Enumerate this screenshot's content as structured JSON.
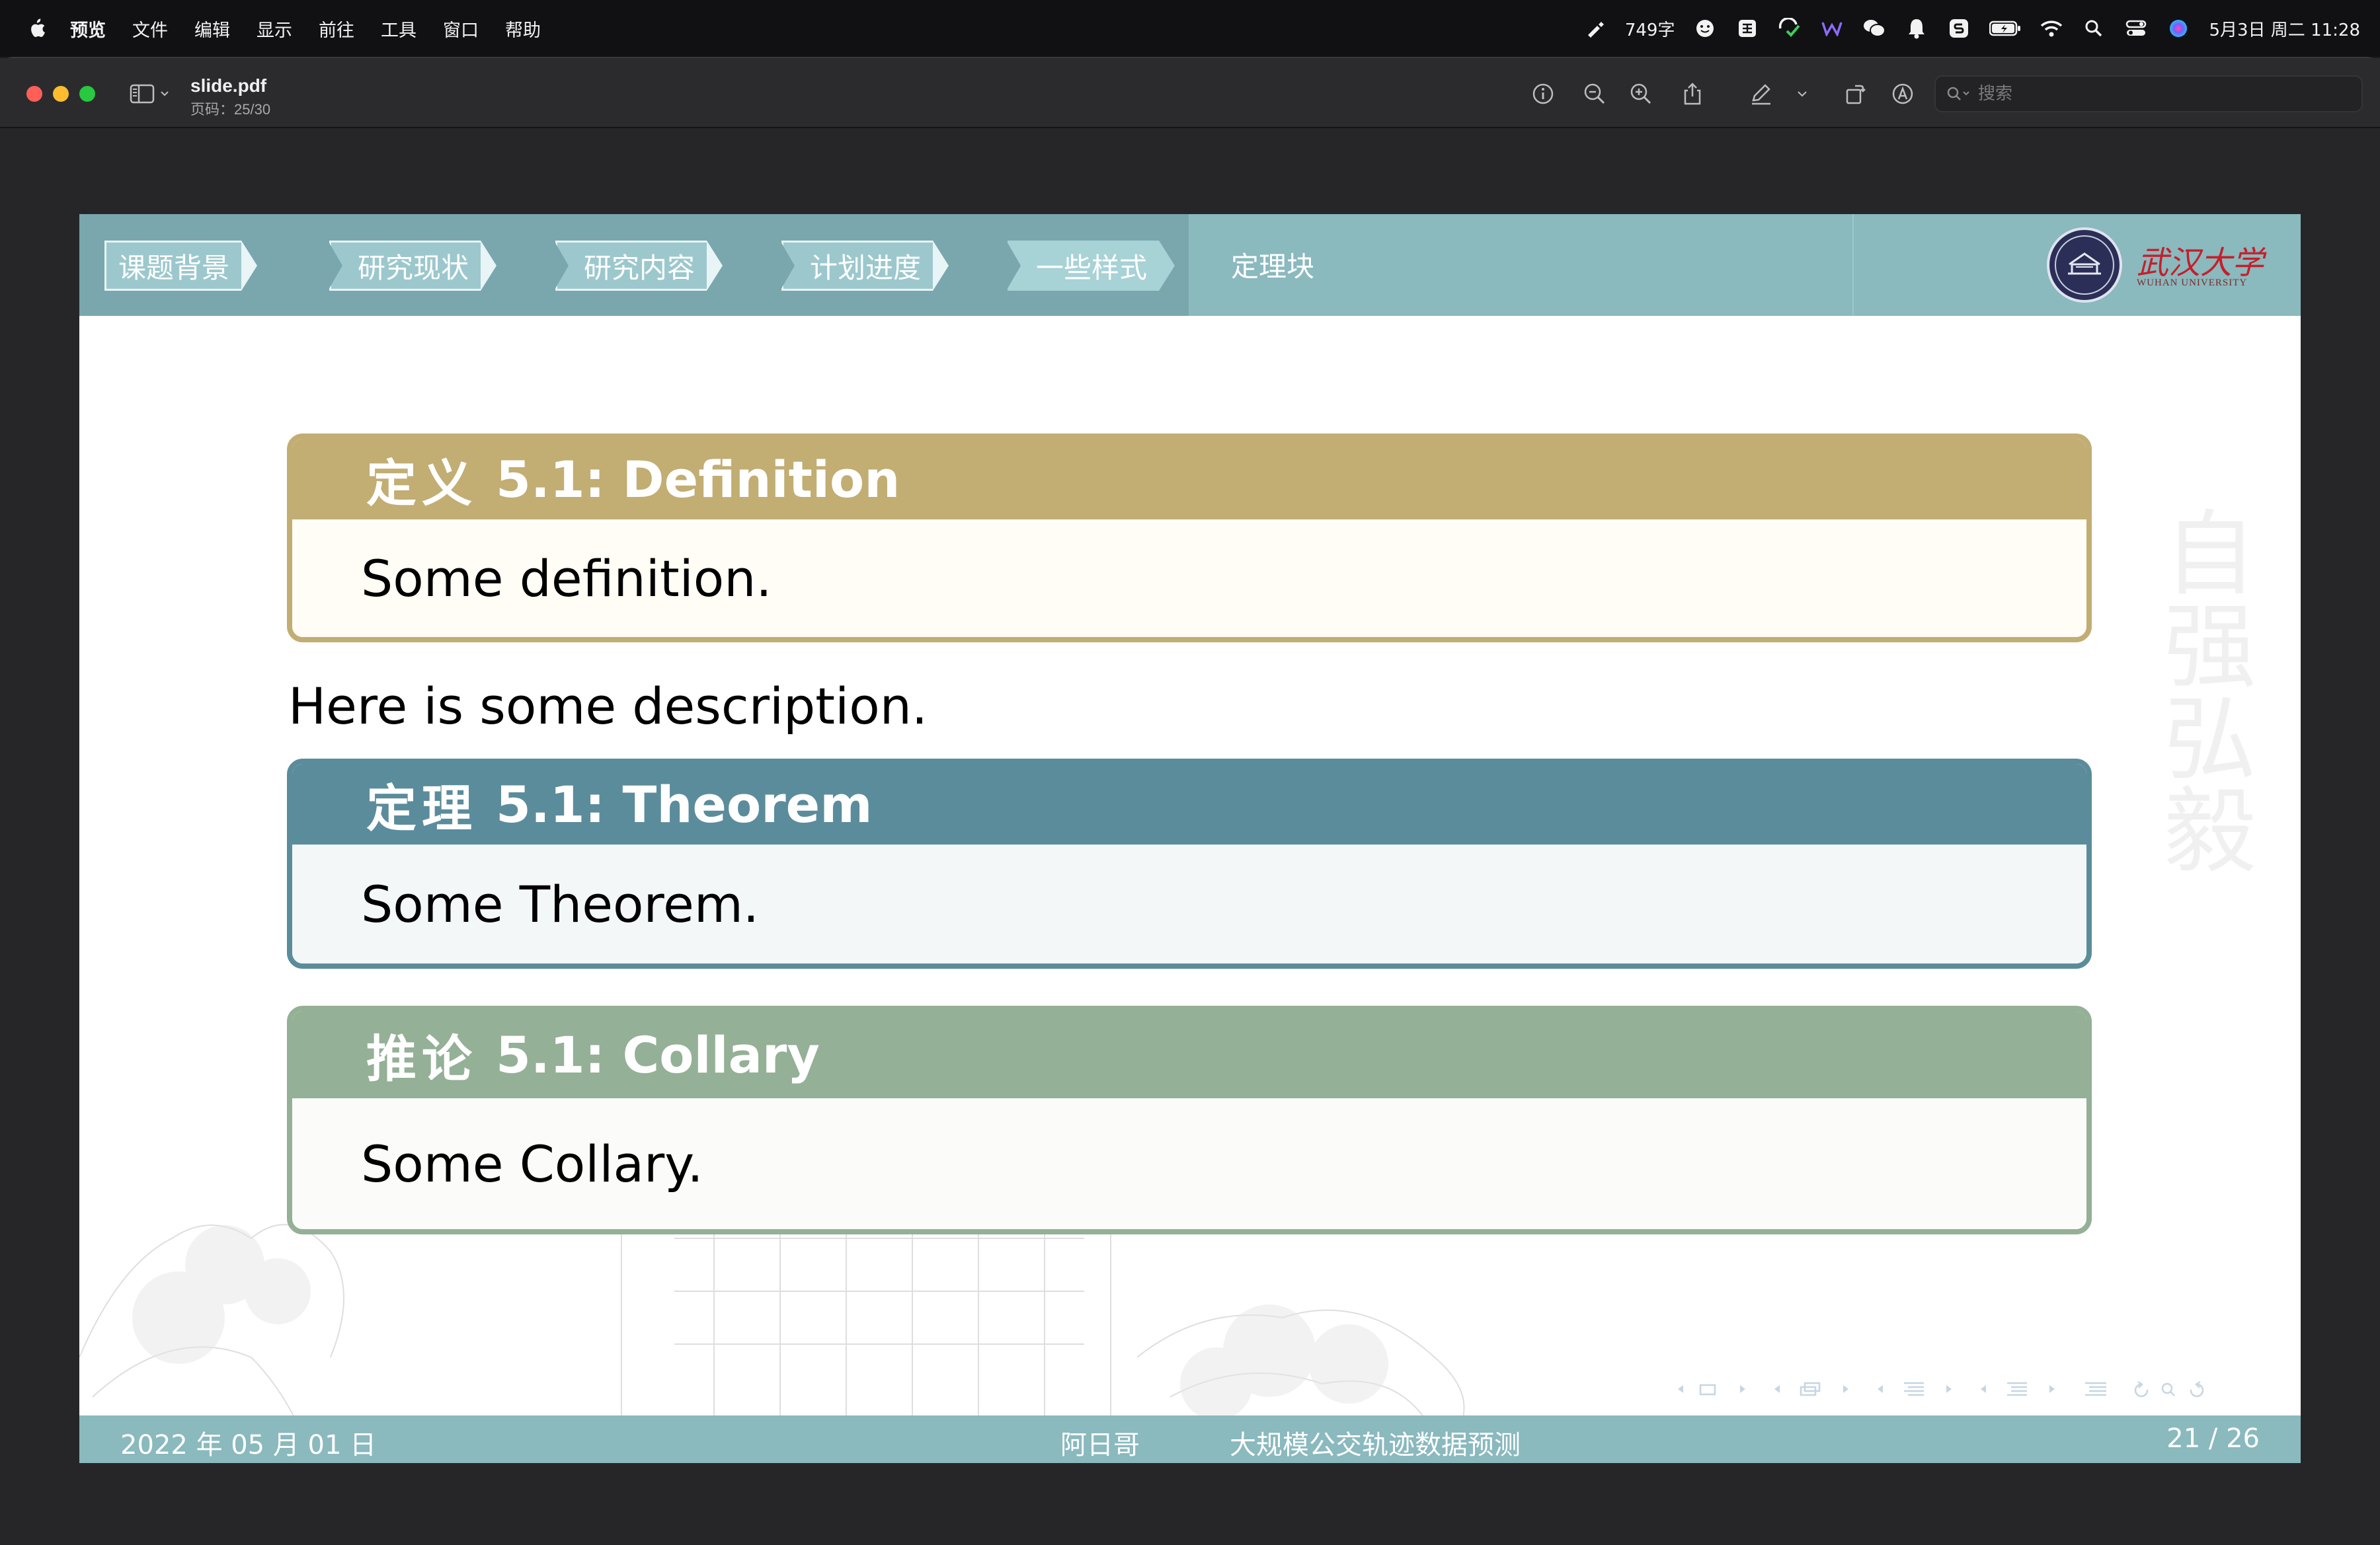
{
  "menubar": {
    "app_name": "预览",
    "items": [
      "文件",
      "编辑",
      "显示",
      "前往",
      "工具",
      "窗口",
      "帮助"
    ],
    "word_count": "749字",
    "clock": "5月3日 周二 11:28"
  },
  "toolbar": {
    "doc_name": "slide.pdf",
    "page_label": "页码：25/30",
    "search_placeholder": "搜索"
  },
  "slide": {
    "nav_sections": [
      "课题背景",
      "研究现状",
      "研究内容",
      "计划进度",
      "一些样式"
    ],
    "active_section_index": 4,
    "subsection": "定理块",
    "logo_text": "武汉大学",
    "logo_subtext": "WUHAN UNIVERSITY",
    "watermark_motto": "自强弘毅",
    "blocks": {
      "definition": {
        "zh": "定义",
        "title": "5.1: Definition",
        "body": "Some definition.",
        "color": "#c2ad73"
      },
      "theorem": {
        "zh": "定理",
        "title": "5.1: Theorem",
        "body": "Some Theorem.",
        "color": "#5b8c9c"
      },
      "corollary": {
        "zh": "推论",
        "title": "5.1: Collary",
        "body": "Some Collary.",
        "color": "#94b096"
      }
    },
    "description": "Here is some description.",
    "footer": {
      "date": "2022 年 05 月 01 日",
      "author": "阿日哥",
      "title": "大规模公交轨迹数据预测",
      "page": "21 / 26"
    }
  },
  "colors": {
    "header_teal": "#8ab9be",
    "header_dark_teal": "#79a7ad",
    "logo_red": "#c51f2a"
  }
}
